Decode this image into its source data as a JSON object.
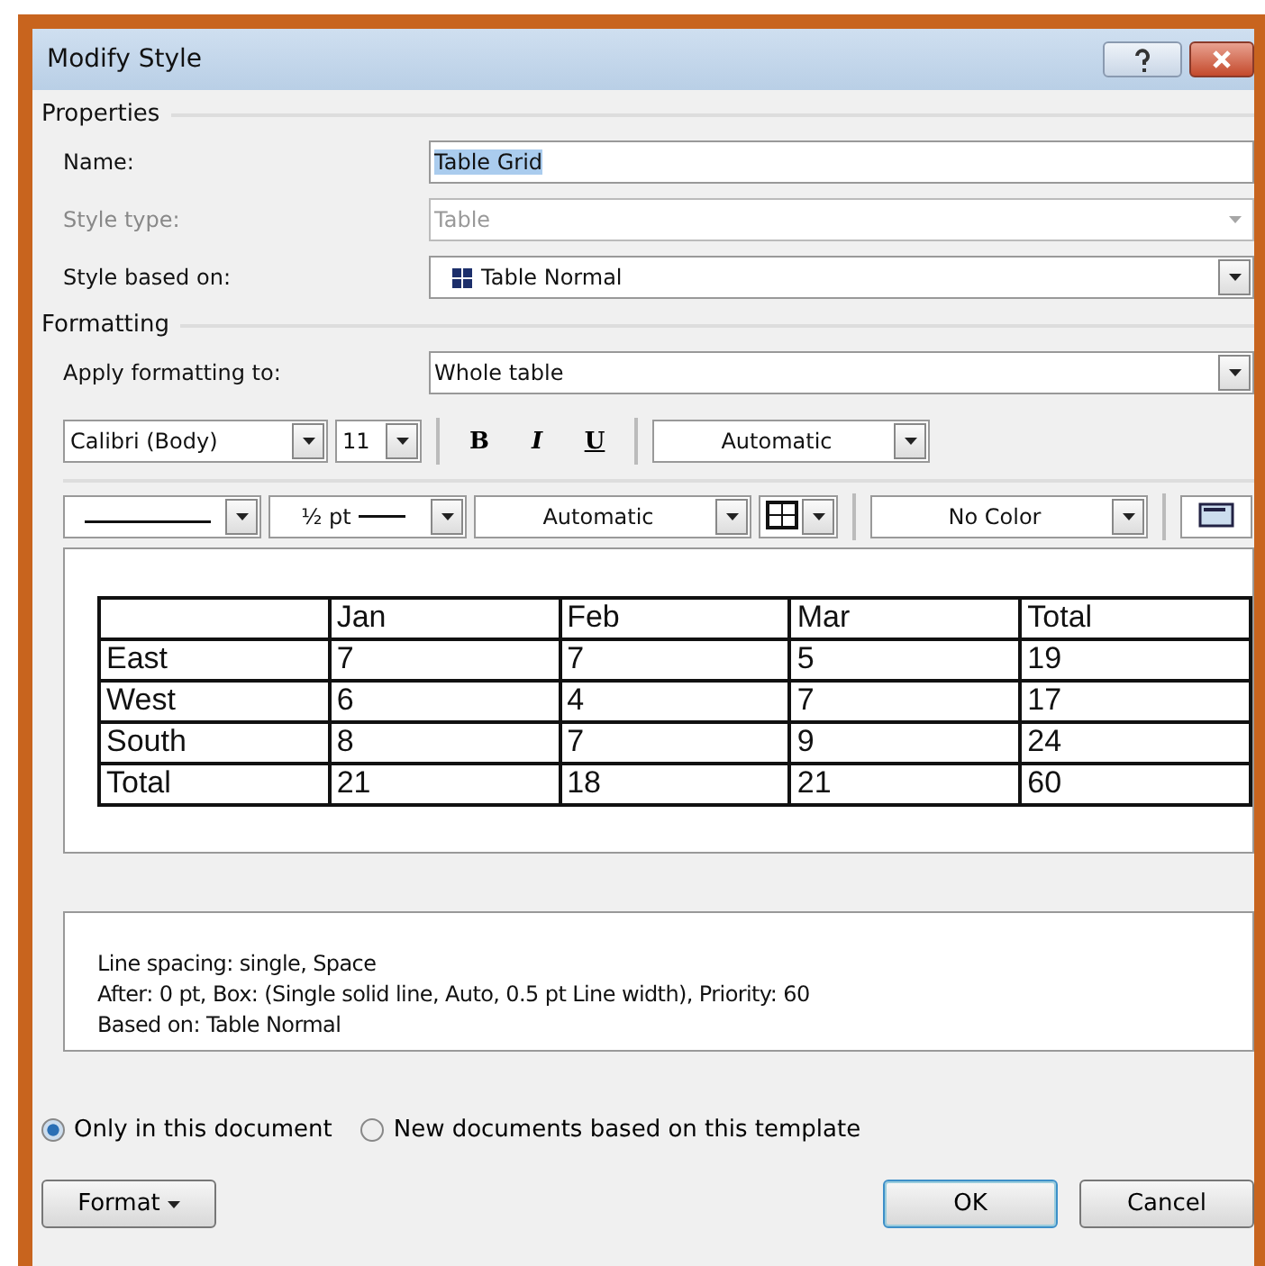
{
  "window": {
    "title": "Modify Style"
  },
  "properties": {
    "heading": "Properties",
    "fields": [
      {
        "label": "Name:",
        "kind": "text",
        "value": "Table Grid",
        "disabled": false,
        "highlighted": true
      },
      {
        "label": "Style type:",
        "kind": "dropdown",
        "value": "Table",
        "disabled": true,
        "highlighted": false
      },
      {
        "label": "Style based on:",
        "kind": "dropdown",
        "value": "Table Normal",
        "disabled": false,
        "highlighted": false,
        "icon": true
      }
    ]
  },
  "formatting": {
    "heading": "Formatting",
    "apply_label": "Apply formatting to:",
    "apply_value": "Whole table",
    "font": "Calibri (Body)",
    "size": "11",
    "styles": [
      "B",
      "I",
      "U"
    ],
    "font_color": "Automatic",
    "line_weight": "½ pt",
    "border_color": "Automatic",
    "shading": "No Color"
  },
  "preview": {
    "columns": [
      "",
      "Jan",
      "Feb",
      "Mar",
      "Total"
    ],
    "rows": [
      [
        "East",
        "7",
        "7",
        "5",
        "19"
      ],
      [
        "West",
        "6",
        "4",
        "7",
        "17"
      ],
      [
        "South",
        "8",
        "7",
        "9",
        "24"
      ],
      [
        "Total",
        "21",
        "18",
        "21",
        "60"
      ]
    ]
  },
  "description": [
    "Line spacing:  single, Space",
    "After:  0 pt, Box: (Single solid line, Auto,  0.5 pt Line width), Priority: 60",
    "Based on: Table Normal"
  ],
  "scope": [
    {
      "label": "Only in this document",
      "selected": true
    },
    {
      "label": "New documents based on this template",
      "selected": false
    }
  ],
  "buttons": [
    {
      "label": "Format",
      "kind": "menu",
      "default": false
    },
    {
      "label": "OK",
      "kind": "plain",
      "default": true
    },
    {
      "label": "Cancel",
      "kind": "plain",
      "default": false
    }
  ]
}
